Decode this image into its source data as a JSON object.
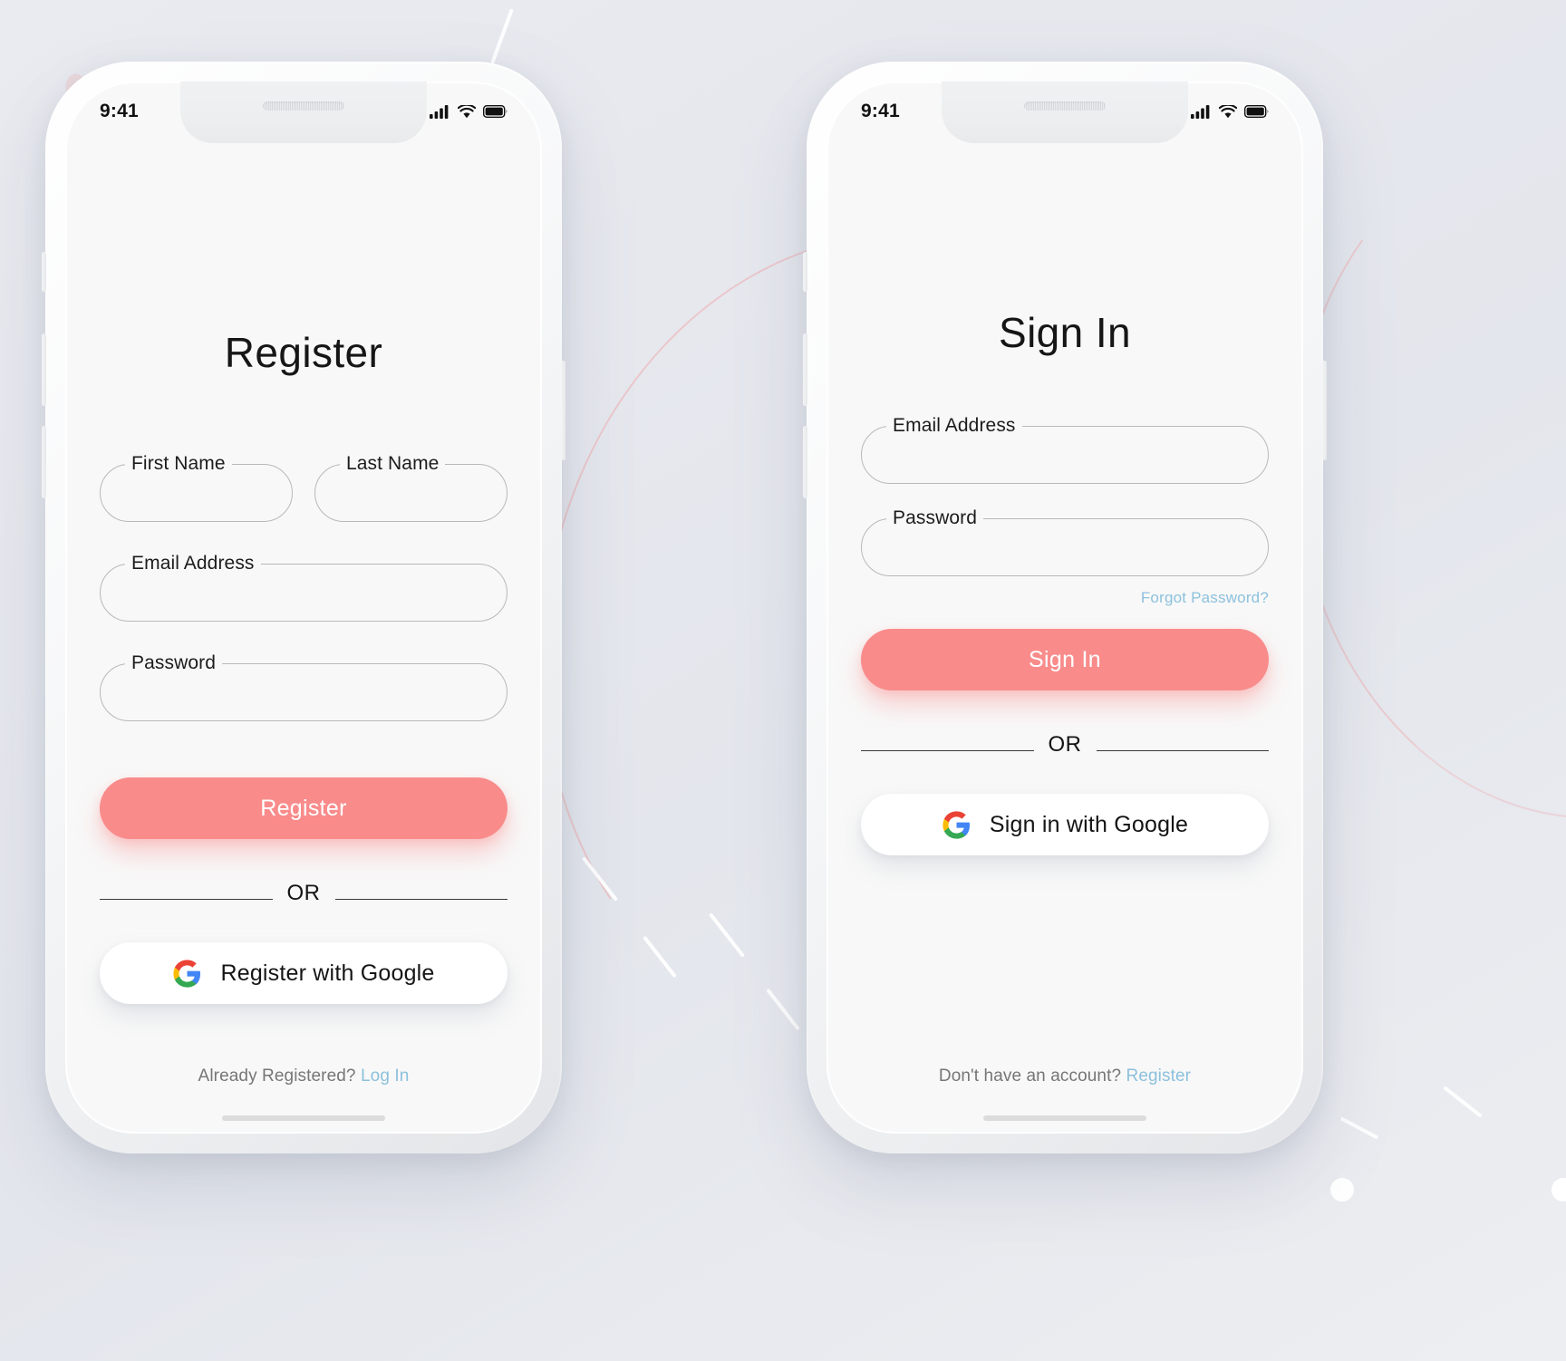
{
  "background": {
    "accent_pink": "#f98b8b",
    "link_blue": "#8cc1dd",
    "screen_bg": "#f8f8f8",
    "page_bg": "#e6e8ee"
  },
  "screens": [
    {
      "id": "register",
      "status_bar": {
        "time": "9:41",
        "icons": [
          "cellular-signal-icon",
          "wifi-icon",
          "battery-icon"
        ]
      },
      "title": "Register",
      "fields": [
        {
          "name": "first-name",
          "label": "First Name",
          "value": "",
          "placeholder": ""
        },
        {
          "name": "last-name",
          "label": "Last Name",
          "value": "",
          "placeholder": ""
        },
        {
          "name": "email-address",
          "label": "Email Address",
          "value": "",
          "placeholder": ""
        },
        {
          "name": "password",
          "label": "Password",
          "value": "",
          "placeholder": ""
        }
      ],
      "primary_button": "Register",
      "divider_text": "OR",
      "google_button": "Register with Google",
      "google_icon": "google-g-icon",
      "footer": {
        "text": "Already Registered?",
        "link": "Log In"
      }
    },
    {
      "id": "sign-in",
      "status_bar": {
        "time": "9:41",
        "icons": [
          "cellular-signal-icon",
          "wifi-icon",
          "battery-icon"
        ]
      },
      "title": "Sign In",
      "fields": [
        {
          "name": "email-address",
          "label": "Email Address",
          "value": "",
          "placeholder": ""
        },
        {
          "name": "password",
          "label": "Password",
          "value": "",
          "placeholder": ""
        }
      ],
      "forgot_password": "Forgot Password?",
      "primary_button": "Sign In",
      "divider_text": "OR",
      "google_button": "Sign in with Google",
      "google_icon": "google-g-icon",
      "footer": {
        "text": "Don't have an account?",
        "link": "Register"
      }
    }
  ]
}
